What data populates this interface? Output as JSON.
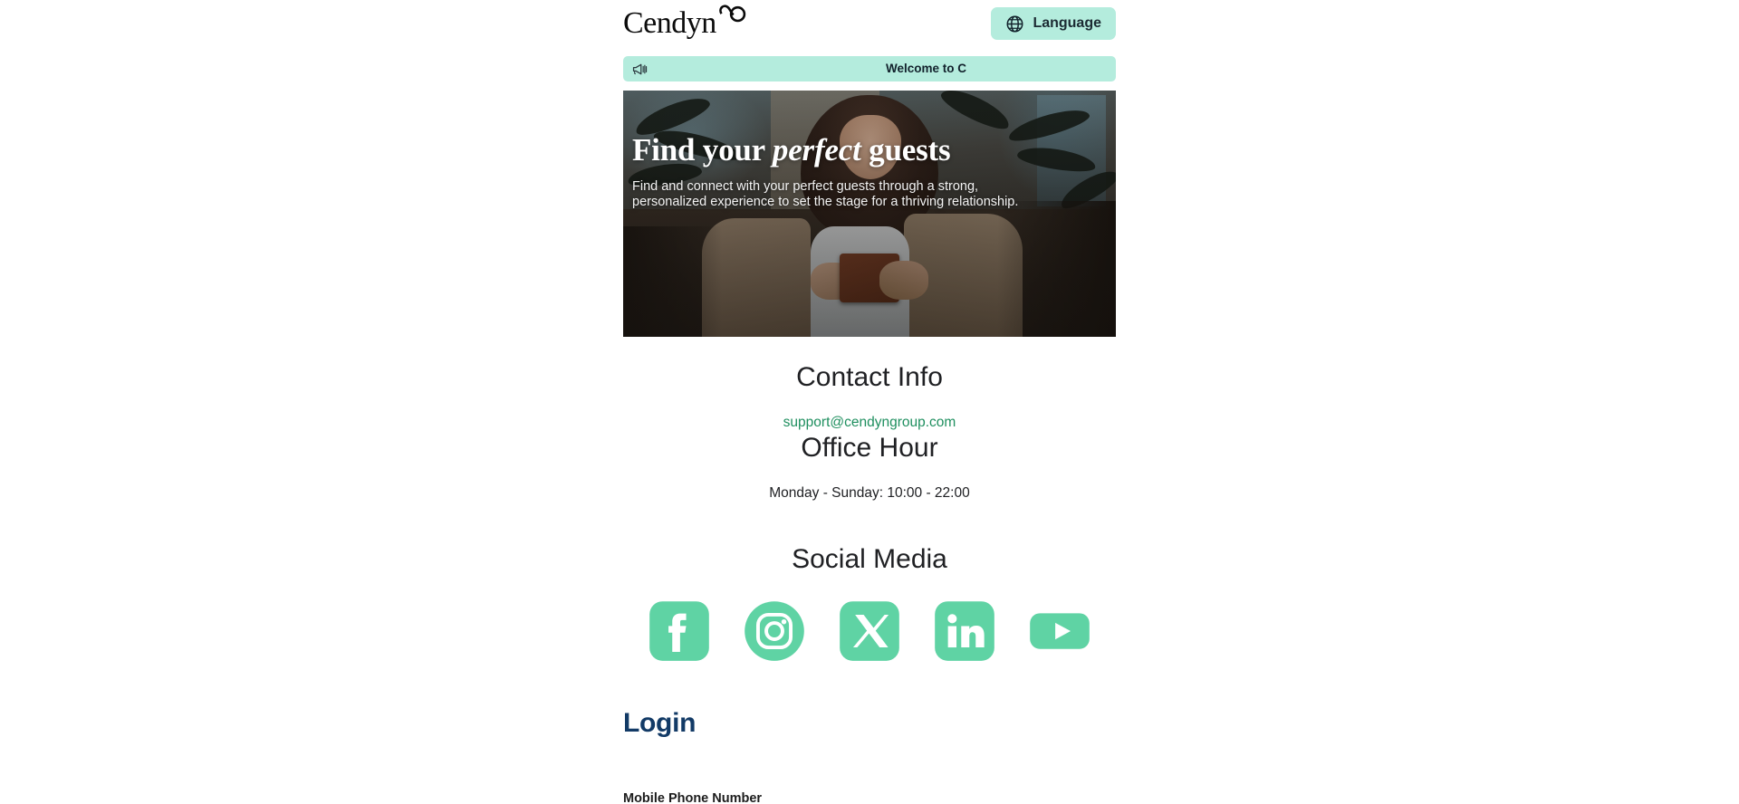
{
  "header": {
    "logo_text": "Cendyn",
    "logo_icon": "infinity-icon",
    "language_button": {
      "label": "Language",
      "icon": "globe-icon"
    }
  },
  "announcement": {
    "icon": "megaphone-icon",
    "text": "Welcome to C",
    "background": "#b4ecdd"
  },
  "hero": {
    "title_part1": "Find your ",
    "title_italic": "perfect",
    "title_part2": " guests",
    "subtitle": "Find and connect with your perfect guests through a strong, personalized experience to set the stage for a thriving relationship."
  },
  "contact": {
    "heading": "Contact Info",
    "email": "support@cendyngroup.com",
    "email_color": "#1f8f5f"
  },
  "office": {
    "heading": "Office Hour",
    "hours": "Monday - Sunday: 10:00 - 22:00"
  },
  "social": {
    "heading": "Social Media",
    "accent_color": "#5fd3a4",
    "items": [
      {
        "name": "facebook",
        "icon": "facebook-icon",
        "label": "Facebook"
      },
      {
        "name": "instagram",
        "icon": "instagram-icon",
        "label": "Instagram"
      },
      {
        "name": "x",
        "icon": "x-twitter-icon",
        "label": "X"
      },
      {
        "name": "linkedin",
        "icon": "linkedin-icon",
        "label": "LinkedIn"
      },
      {
        "name": "youtube",
        "icon": "youtube-icon",
        "label": "YouTube"
      }
    ]
  },
  "login": {
    "heading": "Login",
    "heading_color": "#123a66",
    "phone_label": "Mobile Phone Number"
  }
}
